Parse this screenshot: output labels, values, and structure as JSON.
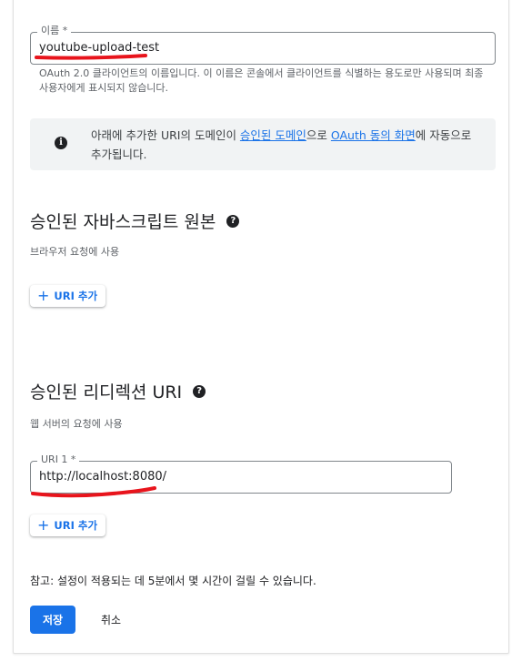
{
  "name_field": {
    "label": "이름 *",
    "value": "youtube-upload-test",
    "helper": "OAuth 2.0 클라이언트의 이름입니다. 이 이름은 콘솔에서 클라이언트를 식별하는 용도로만 사용되며 최종 사용자에게 표시되지 않습니다."
  },
  "info_box": {
    "icon": "info-icon",
    "text_before": "아래에 추가한 URI의 도메인이 ",
    "link1": "승인된 도메인",
    "text_middle": "으로 ",
    "link2": "OAuth 동의 화면",
    "text_after": "에 자동으로 추가됩니다."
  },
  "js_origins": {
    "title": "승인된 자바스크립트 원본",
    "help_icon": "help-icon",
    "description": "브라우저 요청에 사용",
    "add_button": "URI 추가"
  },
  "redirect_uris": {
    "title": "승인된 리디렉션 URI",
    "help_icon": "help-icon",
    "description": "웹 서버의 요청에 사용",
    "field_label": "URI 1 *",
    "field_value": "http://localhost:8080/",
    "add_button": "URI 추가"
  },
  "note": "참고: 설정이 적용되는 데 5분에서 몇 시간이 걸릴 수 있습니다.",
  "actions": {
    "save": "저장",
    "cancel": "취소"
  },
  "colors": {
    "accent": "#1a73e8",
    "annotation_red": "#e8141c"
  }
}
